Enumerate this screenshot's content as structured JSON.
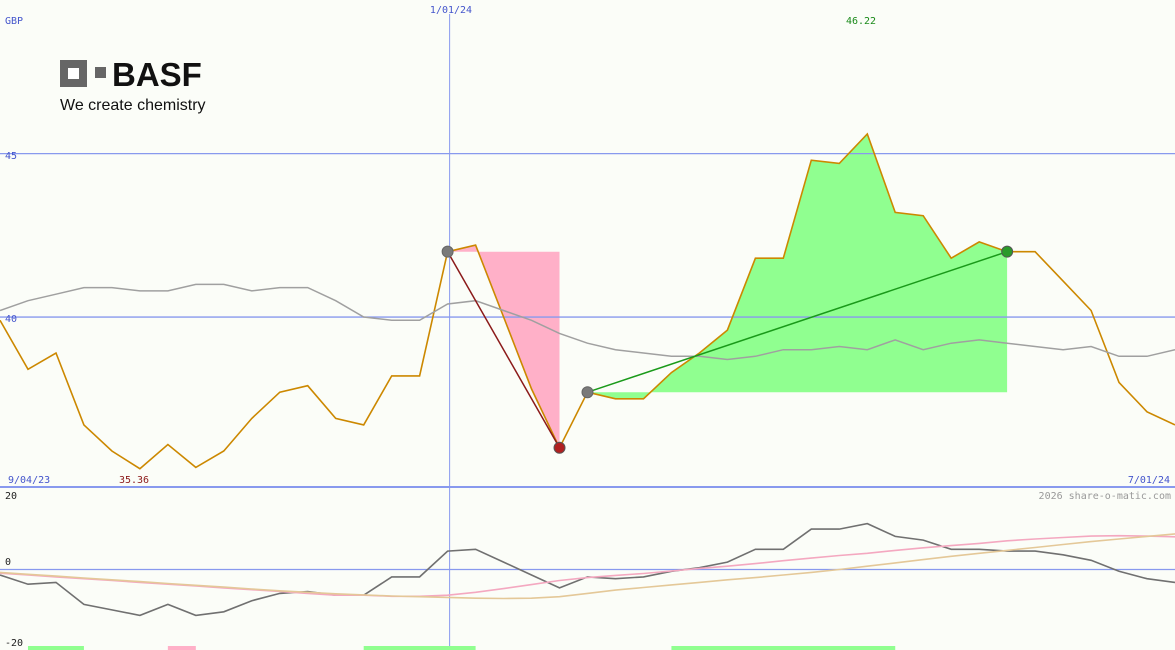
{
  "brand": {
    "name": "BASF",
    "tagline": "We create chemistry",
    "logo_color": "#666666",
    "text_color": "#111111"
  },
  "watermark": "2026 share-o-matic.com",
  "chart_data": [
    {
      "type": "line",
      "currency": "GBP",
      "x_labels": {
        "start": "9/04/23",
        "marker": "1/01/24",
        "end": "7/01/24"
      },
      "y_ticks": [
        40,
        45
      ],
      "ylim": [
        34.8,
        49.7
      ],
      "grid": true,
      "annotations": {
        "max": 46.22,
        "min": 35.36
      },
      "colors": {
        "price": "#cc8800",
        "comparison": "#a0a0a0",
        "gain_fill": "#90ff90",
        "loss_fill": "#ffb0c8",
        "gain_line": "#1a9a1a",
        "loss_line": "#8b1a1a",
        "grid": "#8899ee",
        "label": "#4455cc"
      },
      "series": [
        {
          "key": "price",
          "values": [
            39.9,
            38.4,
            38.9,
            36.7,
            35.9,
            35.36,
            36.1,
            35.4,
            35.9,
            36.9,
            37.7,
            37.9,
            36.9,
            36.7,
            38.2,
            38.2,
            42.0,
            42.2,
            40.0,
            37.8,
            36.0,
            37.7,
            37.5,
            37.5,
            38.3,
            38.9,
            39.6,
            41.8,
            41.8,
            44.8,
            44.7,
            45.6,
            43.2,
            43.1,
            41.8,
            42.3,
            42.0,
            42.0,
            41.1,
            40.2,
            38.0,
            37.1,
            36.7
          ]
        },
        {
          "key": "comparison",
          "values": [
            40.2,
            40.5,
            40.7,
            40.9,
            40.9,
            40.8,
            40.8,
            41.0,
            41.0,
            40.8,
            40.9,
            40.9,
            40.5,
            40.0,
            39.9,
            39.9,
            40.4,
            40.5,
            40.2,
            39.9,
            39.5,
            39.2,
            39.0,
            38.9,
            38.8,
            38.8,
            38.7,
            38.8,
            39.0,
            39.0,
            39.1,
            39.0,
            39.3,
            39.0,
            39.2,
            39.3,
            39.2,
            39.1,
            39.0,
            39.1,
            38.8,
            38.8,
            39.0
          ]
        }
      ],
      "trades": [
        {
          "result": "loss",
          "entry_index": 16,
          "entry_value": 42.0,
          "exit_index": 20,
          "exit_value": 36.0
        },
        {
          "result": "gain",
          "entry_index": 21,
          "entry_value": 37.7,
          "exit_index": 36,
          "exit_value": 42.0
        }
      ]
    },
    {
      "type": "line",
      "y_ticks": [
        20,
        0,
        -20
      ],
      "ylim": [
        -20,
        20
      ],
      "colors": {
        "oscillator": "#707070",
        "signal_fast": "#f4a8c0",
        "signal_slow": "#e4c898"
      },
      "series": [
        {
          "key": "oscillator",
          "values": [
            -1.5,
            -4.0,
            -3.5,
            -9.5,
            -11.0,
            -12.5,
            -9.5,
            -12.5,
            -11.5,
            -8.5,
            -6.5,
            -6.0,
            -7.0,
            -7.0,
            -2.0,
            -2.0,
            5.0,
            5.5,
            2.0,
            -1.5,
            -5.0,
            -2.0,
            -2.5,
            -2.0,
            -0.5,
            0.5,
            2.0,
            5.5,
            5.5,
            11.0,
            11.0,
            12.5,
            9.0,
            8.0,
            5.5,
            5.5,
            5.0,
            5.0,
            4.0,
            2.5,
            -0.5,
            -2.5,
            -3.5
          ]
        },
        {
          "key": "signal_fast",
          "values": [
            -1,
            -1.5,
            -2,
            -2.5,
            -3,
            -3.5,
            -4,
            -4.5,
            -5,
            -5.5,
            -6,
            -6.5,
            -7,
            -7,
            -7.3,
            -7.3,
            -7,
            -6.2,
            -5.2,
            -4.1,
            -3,
            -2.2,
            -1.6,
            -1.1,
            -0.4,
            0.3,
            0.9,
            1.6,
            2.4,
            3.1,
            3.8,
            4.4,
            5.2,
            5.9,
            6.5,
            7.1,
            7.8,
            8.3,
            8.7,
            9.1,
            9.2,
            9.1,
            8.9
          ]
        },
        {
          "key": "signal_slow",
          "values": [
            -0.8,
            -1.3,
            -1.8,
            -2.3,
            -2.8,
            -3.3,
            -3.8,
            -4.3,
            -4.8,
            -5.3,
            -5.8,
            -6.2,
            -6.6,
            -6.9,
            -7.2,
            -7.4,
            -7.6,
            -7.8,
            -7.9,
            -7.8,
            -7.4,
            -6.5,
            -5.6,
            -4.9,
            -4.2,
            -3.5,
            -2.8,
            -2.2,
            -1.5,
            -0.8,
            0,
            0.9,
            1.8,
            2.7,
            3.6,
            4.4,
            5.2,
            6.0,
            6.8,
            7.6,
            8.3,
            9.0,
            9.7
          ]
        }
      ],
      "signal_bars": [
        {
          "result": "gain",
          "from_index": 1,
          "to_index": 3
        },
        {
          "result": "loss",
          "from_index": 6,
          "to_index": 7
        },
        {
          "result": "gain",
          "from_index": 13,
          "to_index": 17
        },
        {
          "result": "gain",
          "from_index": 24,
          "to_index": 32
        }
      ]
    }
  ]
}
